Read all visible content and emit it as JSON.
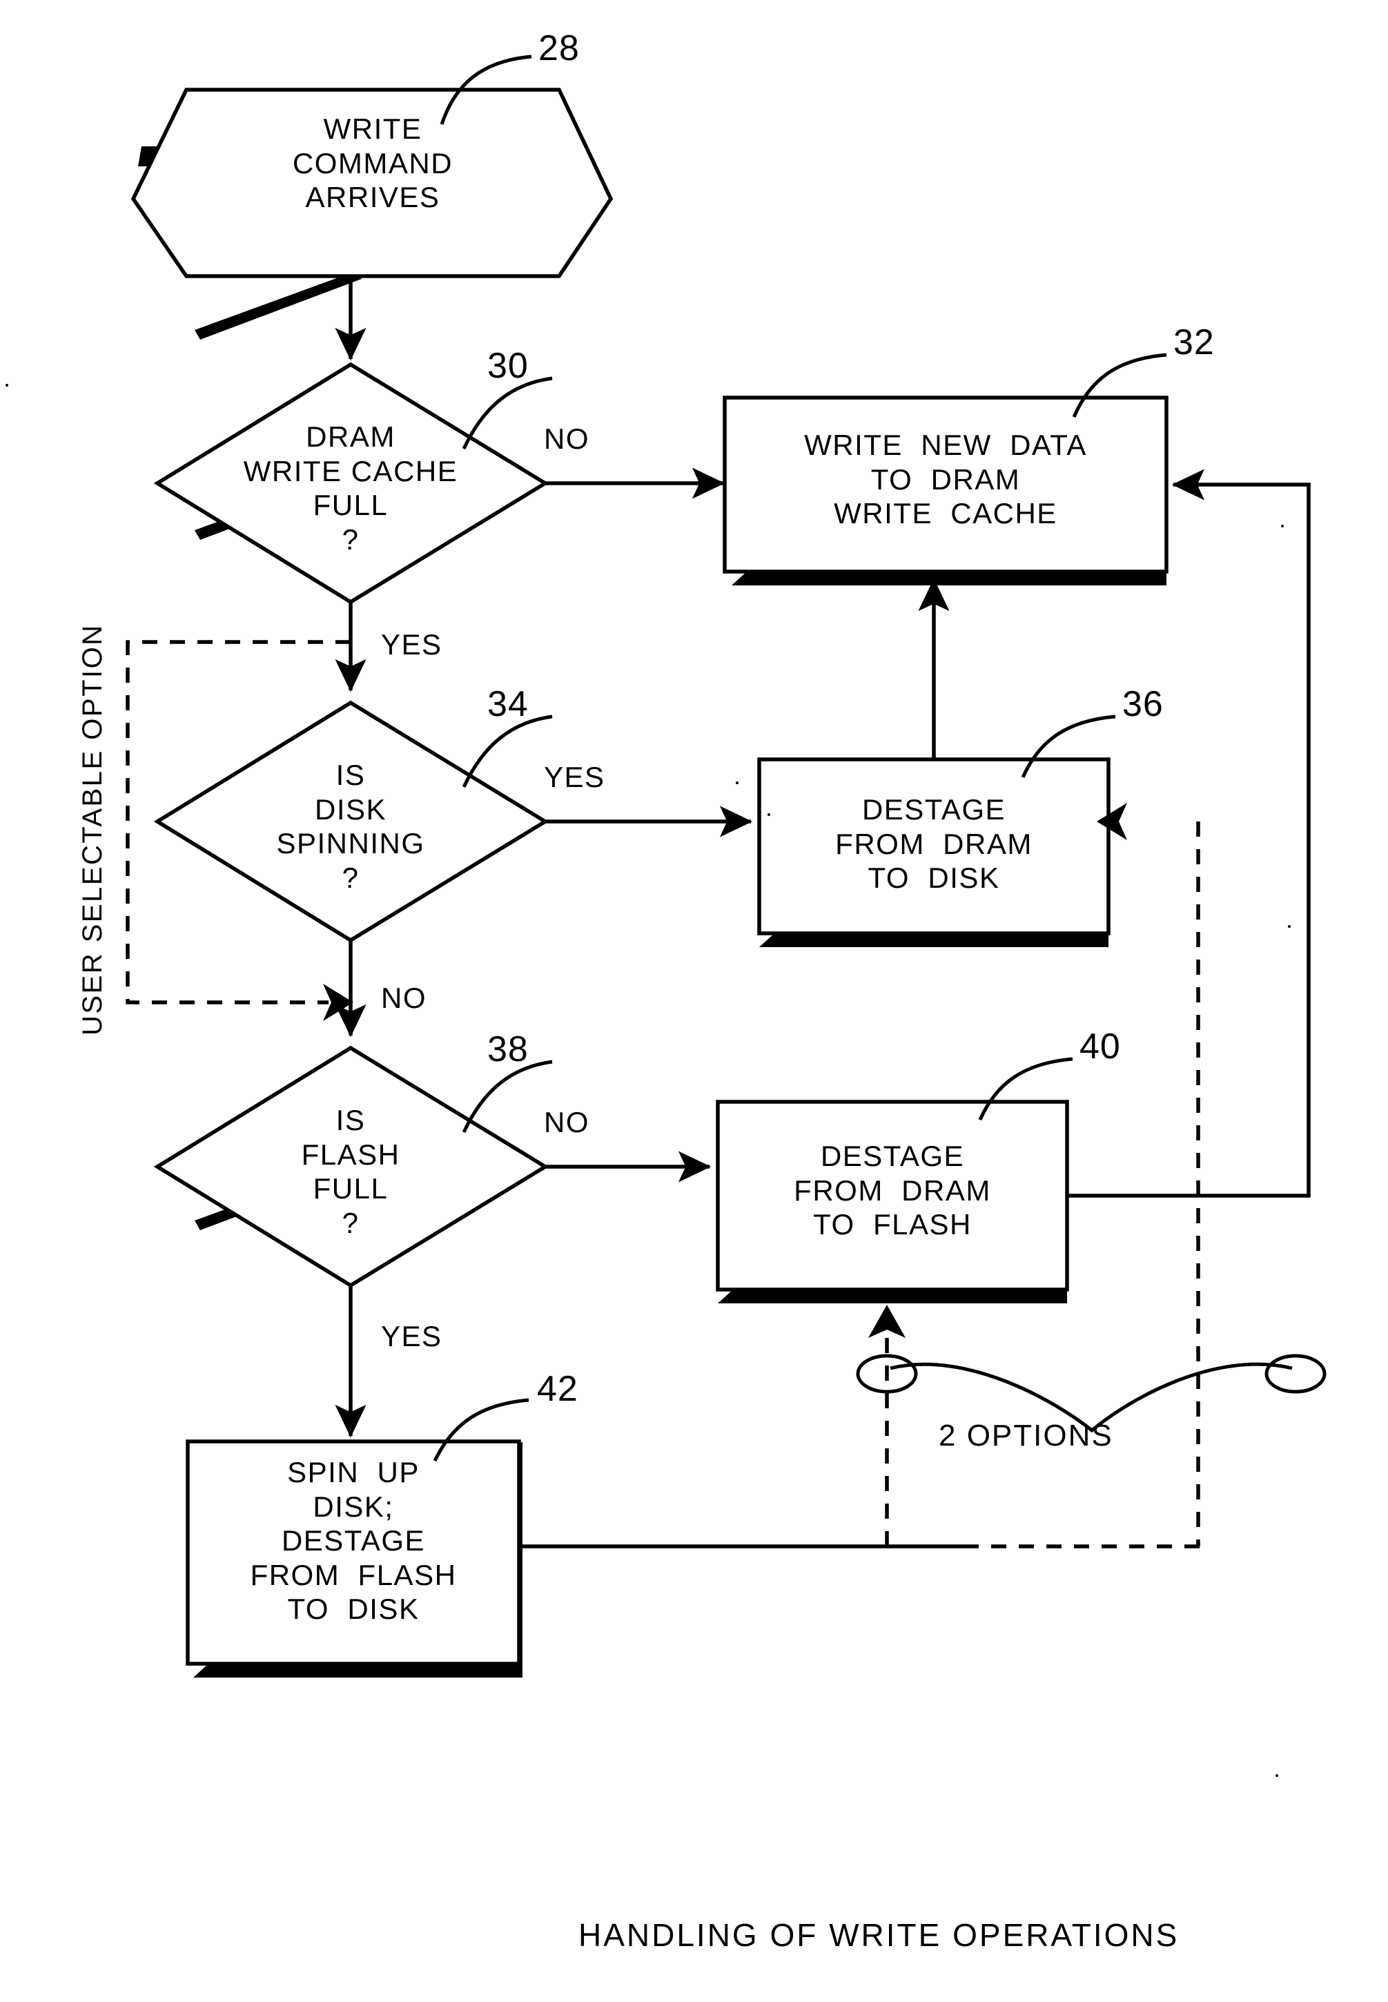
{
  "figure": {
    "caption": "HANDLING OF WRITE OPERATIONS",
    "side_caption": "USER SELECTABLE OPTION",
    "options_note": "2 OPTIONS"
  },
  "nodes": [
    {
      "id": "28",
      "ref": "28",
      "shape": "hexagon",
      "lines": [
        "WRITE",
        "COMMAND",
        "ARRIVES"
      ],
      "text": "WRITE\nCOMMAND\nARRIVES"
    },
    {
      "id": "30",
      "ref": "30",
      "shape": "diamond",
      "lines": [
        "DRAM",
        "WRITE CACHE",
        "FULL",
        "?"
      ],
      "text": "DRAM\nWRITE CACHE\nFULL\n?"
    },
    {
      "id": "32",
      "ref": "32",
      "shape": "rect",
      "lines": [
        "WRITE  NEW  DATA",
        "TO  DRAM",
        "WRITE  CACHE"
      ],
      "text": "WRITE  NEW  DATA\nTO  DRAM\nWRITE  CACHE"
    },
    {
      "id": "34",
      "ref": "34",
      "shape": "diamond",
      "lines": [
        "IS",
        "DISK",
        "SPINNING",
        "?"
      ],
      "text": "IS\nDISK\nSPINNING\n?"
    },
    {
      "id": "36",
      "ref": "36",
      "shape": "rect",
      "lines": [
        "DESTAGE",
        "FROM  DRAM",
        "TO  DISK"
      ],
      "text": "DESTAGE\nFROM  DRAM\nTO  DISK"
    },
    {
      "id": "38",
      "ref": "38",
      "shape": "diamond",
      "lines": [
        "IS",
        "FLASH",
        "FULL",
        "?"
      ],
      "text": "IS\nFLASH\nFULL\n?"
    },
    {
      "id": "40",
      "ref": "40",
      "shape": "rect",
      "lines": [
        "DESTAGE",
        "FROM  DRAM",
        "TO  FLASH"
      ],
      "text": "DESTAGE\nFROM  DRAM\nTO  FLASH"
    },
    {
      "id": "42",
      "ref": "42",
      "shape": "rect",
      "lines": [
        "SPIN  UP",
        "DISK;",
        "DESTAGE",
        "FROM  FLASH",
        "TO  DISK"
      ],
      "text": "SPIN  UP\nDISK;\nDESTAGE\nFROM  FLASH\nTO  DISK"
    }
  ],
  "branch_labels": {
    "dram_no": "NO",
    "dram_yes": "YES",
    "disk_yes": "YES",
    "disk_no": "NO",
    "flash_no": "NO",
    "flash_yes": "YES"
  },
  "colors": {
    "ink": "#000000",
    "paper": "#ffffff"
  }
}
